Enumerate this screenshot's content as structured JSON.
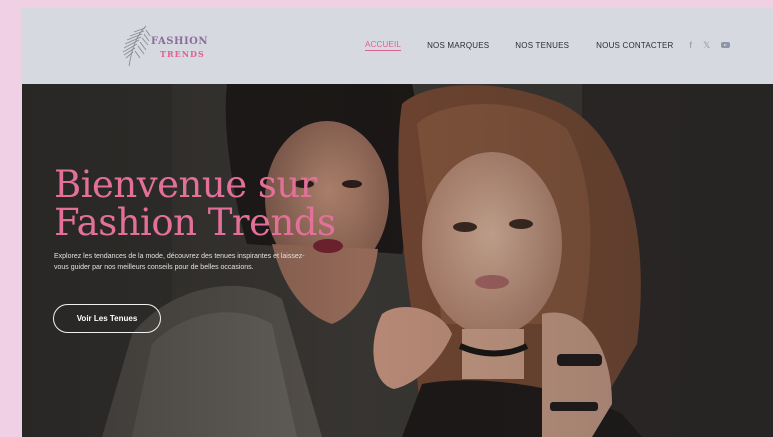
{
  "header": {
    "logo": {
      "line1": "FASHION",
      "line2": "TRENDS"
    },
    "nav": [
      {
        "label": "ACCUEIL",
        "active": true
      },
      {
        "label": "NOS MARQUES",
        "active": false
      },
      {
        "label": "NOS TENUES",
        "active": false
      },
      {
        "label": "NOUS CONTACTER",
        "active": false
      }
    ],
    "social": {
      "facebook": "f",
      "x": "𝕏",
      "youtube": "youtube-icon"
    }
  },
  "hero": {
    "title_line1": "Bienvenue sur",
    "title_line2": "Fashion Trends",
    "lead": "Explorez les tendances de la mode, découvrez des tenues inspirantes et laissez-vous guider par nos meilleurs conseils pour de belles occasions.",
    "cta_label": "Voir Les Tenues"
  },
  "colors": {
    "accent": "#e27099",
    "header_bg": "#d6d9e0",
    "page_bg": "#efd0e4"
  }
}
